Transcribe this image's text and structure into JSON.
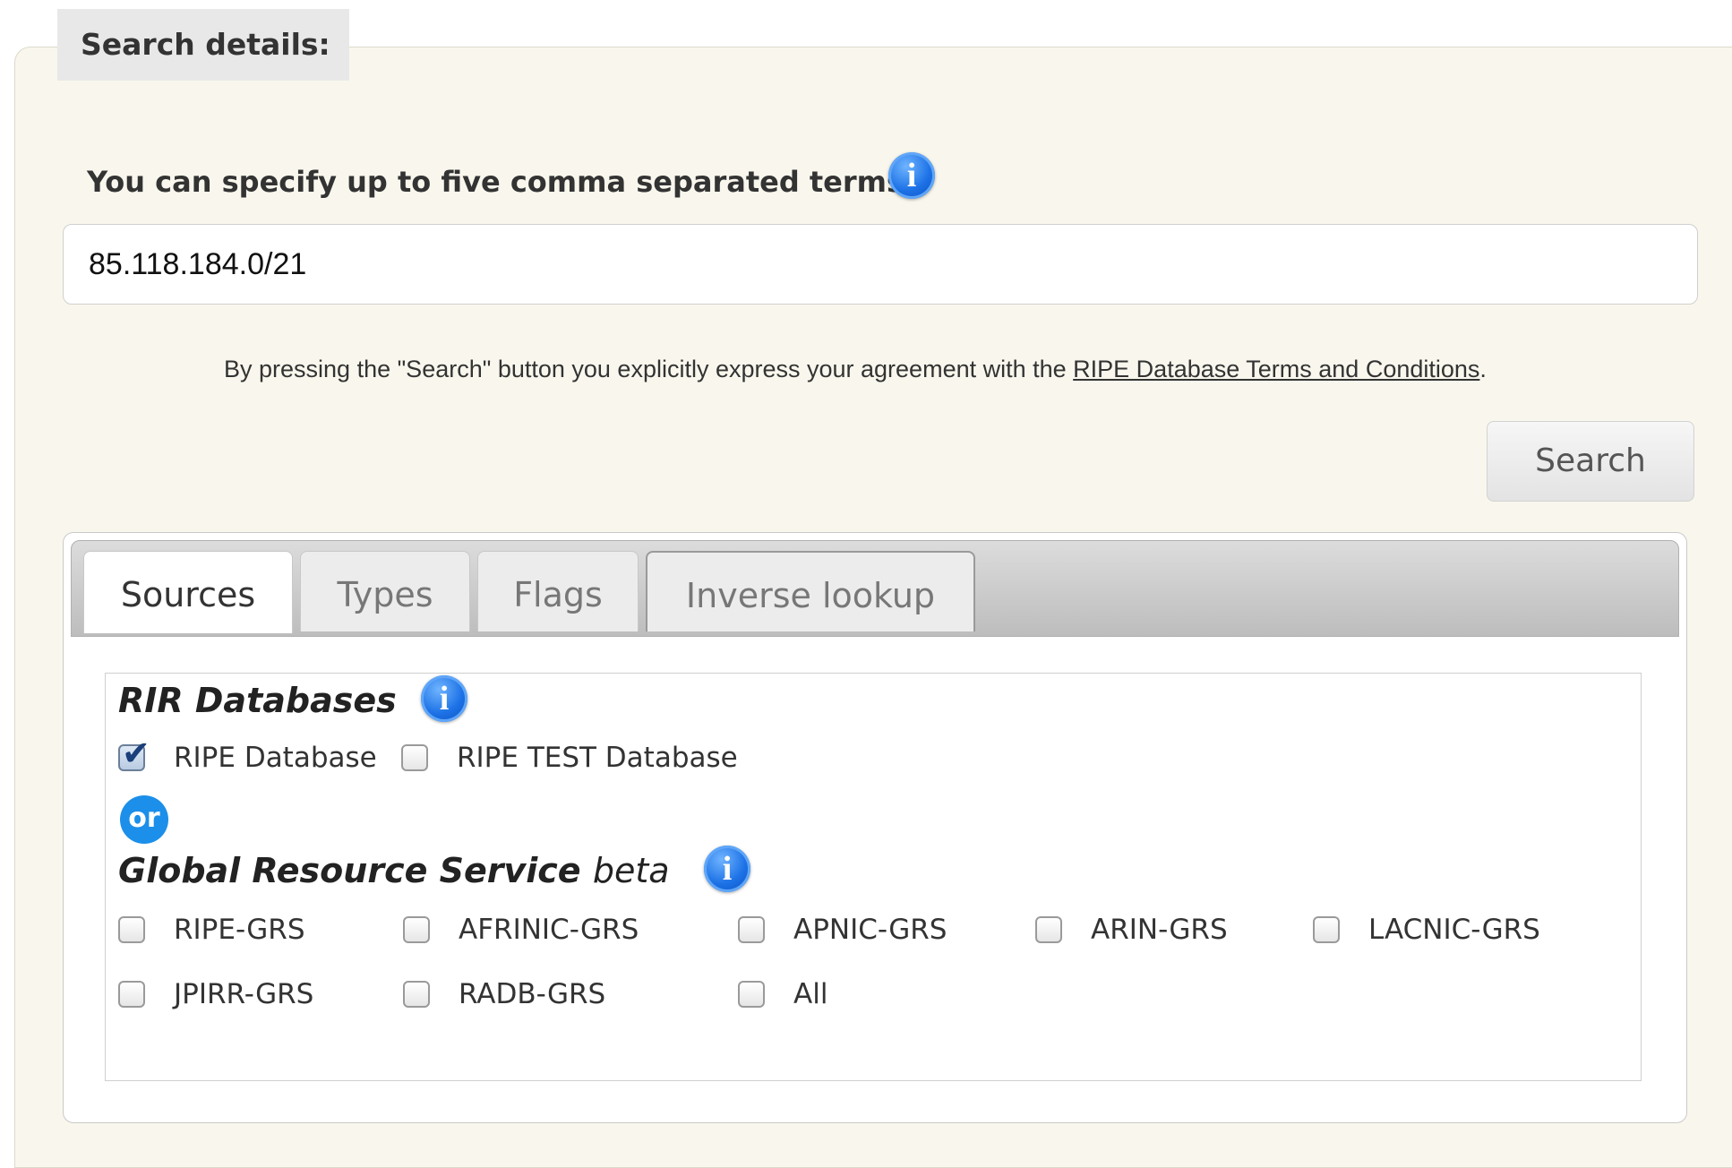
{
  "legend": "Search details:",
  "terms_label": "You can specify up to five comma separated terms:",
  "search_value": "85.118.184.0/21",
  "agreement": {
    "prefix": "By pressing the \"Search\" button you explicitly express your agreement with the ",
    "link": "RIPE Database Terms and Conditions",
    "suffix": "."
  },
  "search_button": "Search",
  "tabs": [
    {
      "label": "Sources",
      "active": true
    },
    {
      "label": "Types",
      "active": false
    },
    {
      "label": "Flags",
      "active": false
    },
    {
      "label": "Inverse lookup",
      "active": false
    }
  ],
  "rir": {
    "heading": "RIR Databases",
    "options": [
      {
        "label": "RIPE Database",
        "checked": true
      },
      {
        "label": "RIPE TEST Database",
        "checked": false
      }
    ]
  },
  "or_label": "or",
  "grs": {
    "heading": "Global Resource Service",
    "heading_suffix": "beta",
    "options": [
      {
        "label": "RIPE-GRS",
        "checked": false
      },
      {
        "label": "AFRINIC-GRS",
        "checked": false
      },
      {
        "label": "APNIC-GRS",
        "checked": false
      },
      {
        "label": "ARIN-GRS",
        "checked": false
      },
      {
        "label": "LACNIC-GRS",
        "checked": false
      },
      {
        "label": "JPIRR-GRS",
        "checked": false
      },
      {
        "label": "RADB-GRS",
        "checked": false
      },
      {
        "label": "All",
        "checked": false
      }
    ]
  },
  "icons": {
    "info": "info-icon",
    "checked": "checkbox-checked-icon"
  },
  "colors": {
    "background": "#f9f7ed",
    "info_blue": "#1d72e6",
    "or_badge": "#1b8fea"
  }
}
